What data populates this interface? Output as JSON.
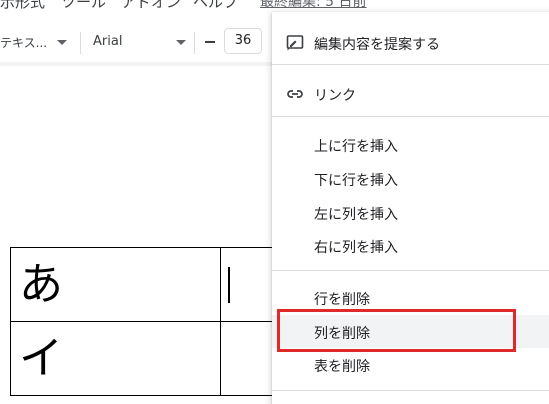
{
  "menubar": {
    "items": [
      "示形式",
      "ツール",
      "アドオン",
      "ヘルプ"
    ],
    "last_edit": "最終編集: 5 日前"
  },
  "toolbar": {
    "style_value": "テキス...",
    "font_value": "Arial",
    "font_size": "36"
  },
  "table": {
    "rows": [
      [
        "あ",
        ""
      ],
      [
        "イ",
        ""
      ]
    ]
  },
  "context_menu": {
    "suggest_edits": "編集内容を提案する",
    "link": "リンク",
    "insert_row_above": "上に行を挿入",
    "insert_row_below": "下に行を挿入",
    "insert_col_left": "左に列を挿入",
    "insert_col_right": "右に列を挿入",
    "delete_row": "行を削除",
    "delete_column": "列を削除",
    "delete_table": "表を削除"
  },
  "colors": {
    "highlight_border": "#e02a2a",
    "hover_bg": "#f1f3f4"
  }
}
